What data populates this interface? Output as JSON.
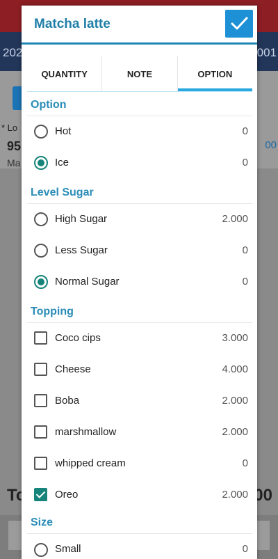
{
  "background": {
    "bar_left": "202",
    "bar_right": "001",
    "note": "* Lo",
    "price": "95",
    "name": "Ma",
    "right_value": "00",
    "total_label": "To",
    "total_value": "00"
  },
  "dialog": {
    "title": "Matcha latte",
    "tabs": [
      {
        "label": "QUANTITY",
        "active": false
      },
      {
        "label": "NOTE",
        "active": false
      },
      {
        "label": "OPTION",
        "active": true
      }
    ],
    "sections": {
      "option": {
        "title": "Option",
        "items": [
          {
            "name": "Hot",
            "price": "0",
            "selected": false
          },
          {
            "name": "Ice",
            "price": "0",
            "selected": true
          }
        ]
      },
      "sugar": {
        "title": "Level Sugar",
        "items": [
          {
            "name": "High Sugar",
            "price": "2.000",
            "selected": false
          },
          {
            "name": "Less Sugar",
            "price": "0",
            "selected": false
          },
          {
            "name": "Normal Sugar",
            "price": "0",
            "selected": true
          }
        ]
      },
      "topping": {
        "title": "Topping",
        "items": [
          {
            "name": "Coco cips",
            "price": "3.000",
            "checked": false
          },
          {
            "name": "Cheese",
            "price": "4.000",
            "checked": false
          },
          {
            "name": "Boba",
            "price": "2.000",
            "checked": false
          },
          {
            "name": "marshmallow",
            "price": "2.000",
            "checked": false
          },
          {
            "name": "whipped cream",
            "price": "0",
            "checked": false
          },
          {
            "name": "Oreo",
            "price": "2.000",
            "checked": true
          }
        ]
      },
      "size": {
        "title": "Size",
        "items": [
          {
            "name": "Small",
            "price": "0",
            "selected": false
          }
        ]
      }
    }
  },
  "colors": {
    "accent": "#1f86b5",
    "selected": "#16847a",
    "confirm": "#1e90d6"
  }
}
